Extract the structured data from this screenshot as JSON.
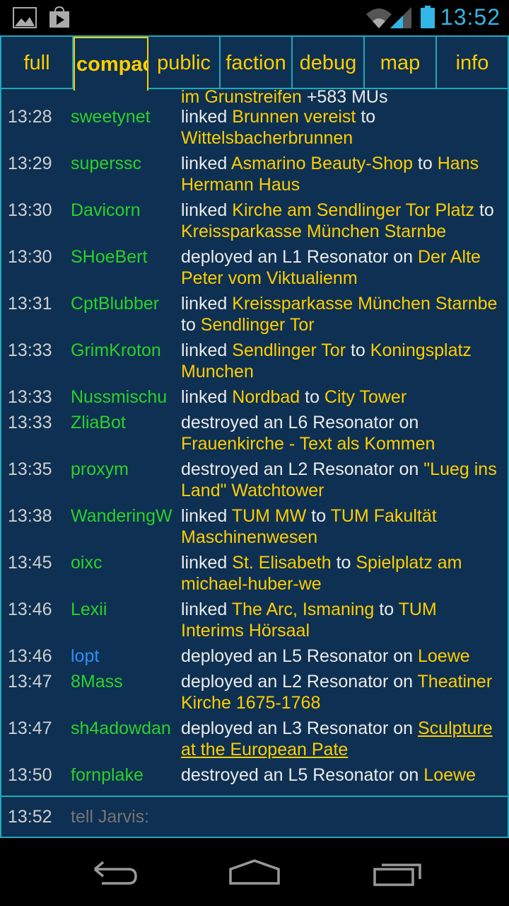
{
  "status_bar": {
    "time": "13:52",
    "icons": [
      "gallery-icon",
      "play-store-icon",
      "wifi-icon",
      "signal-icon",
      "battery-icon"
    ],
    "time_color": "#33b5e5"
  },
  "tabs": [
    {
      "label": "full",
      "active": false
    },
    {
      "label": "compact",
      "active": true
    },
    {
      "label": "public",
      "active": false
    },
    {
      "label": "faction",
      "active": false
    },
    {
      "label": "debug",
      "active": false
    },
    {
      "label": "map",
      "active": false
    },
    {
      "label": "info",
      "active": false
    }
  ],
  "log": {
    "header_fragment": [
      {
        "text": "im Grunstreifen",
        "portal": true
      },
      {
        "text": " +583 MUs",
        "portal": false
      }
    ],
    "rows": [
      {
        "time": "13:28",
        "user": "sweetynet",
        "user_color": "green",
        "parts": [
          {
            "text": "linked ",
            "portal": false
          },
          {
            "text": "Brunnen vereist",
            "portal": true
          },
          {
            "text": " to ",
            "portal": false
          },
          {
            "text": "Wittelsbacherbrunnen",
            "portal": true
          }
        ]
      },
      {
        "time": "13:29",
        "user": "superssc",
        "user_color": "green",
        "parts": [
          {
            "text": "linked ",
            "portal": false
          },
          {
            "text": "Asmarino Beauty-Shop",
            "portal": true
          },
          {
            "text": " to ",
            "portal": false
          },
          {
            "text": "Hans Hermann Haus",
            "portal": true
          }
        ]
      },
      {
        "time": "13:30",
        "user": "Davicorn",
        "user_color": "green",
        "parts": [
          {
            "text": "linked ",
            "portal": false
          },
          {
            "text": "Kirche am Sendlinger Tor Platz",
            "portal": true
          },
          {
            "text": " to ",
            "portal": false
          },
          {
            "text": "Kreissparkasse München Starnbe",
            "portal": true
          }
        ]
      },
      {
        "time": "13:30",
        "user": "SHoeBert",
        "user_color": "green",
        "parts": [
          {
            "text": "deployed an L1 Resonator on ",
            "portal": false
          },
          {
            "text": "Der Alte Peter vom Viktualienm",
            "portal": true
          }
        ]
      },
      {
        "time": "13:31",
        "user": "CptBlubber",
        "user_color": "green",
        "parts": [
          {
            "text": "linked ",
            "portal": false
          },
          {
            "text": "Kreissparkasse München Starnbe",
            "portal": true
          },
          {
            "text": " to ",
            "portal": false
          },
          {
            "text": "Sendlinger Tor",
            "portal": true
          }
        ]
      },
      {
        "time": "13:33",
        "user": "GrimKroton",
        "user_color": "green",
        "parts": [
          {
            "text": "linked ",
            "portal": false
          },
          {
            "text": "Sendlinger Tor",
            "portal": true
          },
          {
            "text": " to ",
            "portal": false
          },
          {
            "text": "Koningsplatz Munchen",
            "portal": true
          }
        ]
      },
      {
        "time": "13:33",
        "user": "Nussmischu",
        "user_color": "green",
        "parts": [
          {
            "text": "linked ",
            "portal": false
          },
          {
            "text": "Nordbad",
            "portal": true
          },
          {
            "text": " to ",
            "portal": false
          },
          {
            "text": "City Tower",
            "portal": true
          }
        ]
      },
      {
        "time": "13:33",
        "user": "ZliaBot",
        "user_color": "green",
        "parts": [
          {
            "text": "destroyed an L6 Resonator on ",
            "portal": false
          },
          {
            "text": "Frauenkirche - Text als Kommen",
            "portal": true
          }
        ]
      },
      {
        "time": "13:35",
        "user": "proxym",
        "user_color": "green",
        "parts": [
          {
            "text": "destroyed an L2 Resonator on ",
            "portal": false
          },
          {
            "text": "\"Lueg ins Land\" Watchtower",
            "portal": true
          }
        ]
      },
      {
        "time": "13:38",
        "user": "WanderingW",
        "user_color": "green",
        "parts": [
          {
            "text": "linked ",
            "portal": false
          },
          {
            "text": "TUM MW",
            "portal": true
          },
          {
            "text": " to ",
            "portal": false
          },
          {
            "text": "TUM Fakultät Maschinenwesen",
            "portal": true
          }
        ]
      },
      {
        "time": "13:45",
        "user": "oixc",
        "user_color": "green",
        "parts": [
          {
            "text": "linked ",
            "portal": false
          },
          {
            "text": "St. Elisabeth",
            "portal": true
          },
          {
            "text": " to ",
            "portal": false
          },
          {
            "text": "Spielplatz am michael-huber-we",
            "portal": true
          }
        ]
      },
      {
        "time": "13:46",
        "user": "Lexii",
        "user_color": "green",
        "parts": [
          {
            "text": "linked ",
            "portal": false
          },
          {
            "text": "The Arc, Ismaning",
            "portal": true
          },
          {
            "text": " to ",
            "portal": false
          },
          {
            "text": "TUM Interims Hörsaal",
            "portal": true
          }
        ]
      },
      {
        "time": "13:46",
        "user": "lopt",
        "user_color": "blue",
        "parts": [
          {
            "text": "deployed an L5 Resonator on ",
            "portal": false
          },
          {
            "text": "Loewe",
            "portal": true
          }
        ]
      },
      {
        "time": "13:47",
        "user": "8Mass",
        "user_color": "green",
        "parts": [
          {
            "text": "deployed an L2 Resonator on ",
            "portal": false
          },
          {
            "text": "Theatiner Kirche 1675-1768",
            "portal": true
          }
        ]
      },
      {
        "time": "13:47",
        "user": "sh4adowdan",
        "user_color": "green",
        "parts": [
          {
            "text": "deployed an L3 Resonator on ",
            "portal": false
          },
          {
            "text": "Sculpture at the European Pate",
            "portal": true,
            "underline": true
          }
        ]
      },
      {
        "time": "13:50",
        "user": "fornplake",
        "user_color": "green",
        "parts": [
          {
            "text": "destroyed an L5 Resonator on ",
            "portal": false
          },
          {
            "text": "Loewe",
            "portal": true
          }
        ]
      }
    ]
  },
  "input": {
    "time": "13:52",
    "placeholder": "tell Jarvis:"
  },
  "nav_bar": {
    "icons": [
      "back-icon",
      "home-icon",
      "recent-apps-icon"
    ]
  },
  "colors": {
    "background": "#0e3052",
    "border": "#20a8b8",
    "portal": "#ffce00",
    "user_green": "#2bd12b",
    "user_blue": "#2d8ff4"
  }
}
